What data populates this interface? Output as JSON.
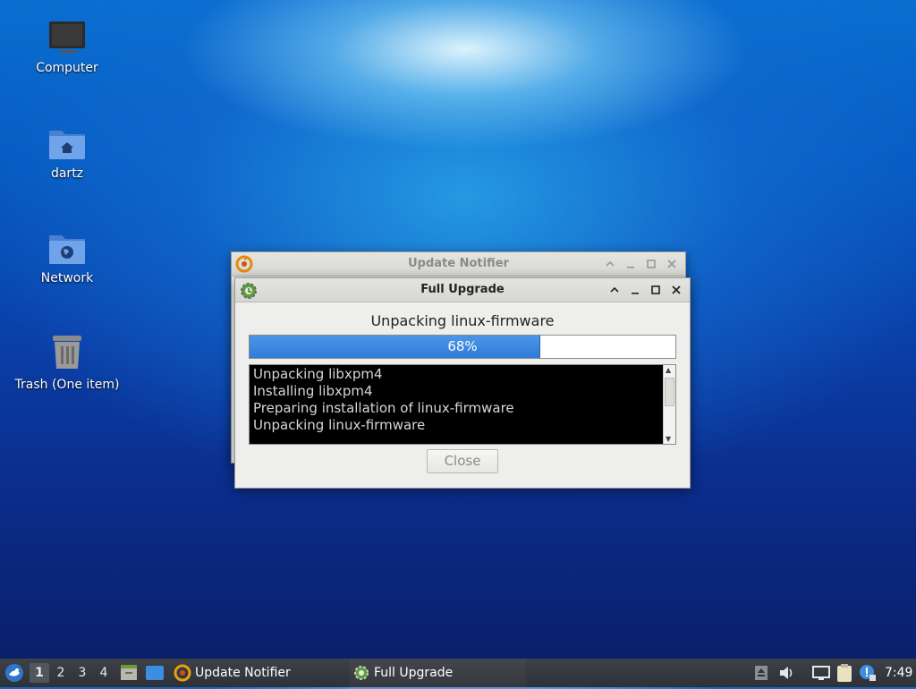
{
  "desktop": {
    "icons": [
      {
        "label": "Computer",
        "icon": "computer-icon"
      },
      {
        "label": "dartz",
        "icon": "home-folder-icon"
      },
      {
        "label": "Network",
        "icon": "network-folder-icon"
      },
      {
        "label": "Trash (One item)",
        "icon": "trash-icon"
      }
    ]
  },
  "update_notifier_window": {
    "title": "Update Notifier",
    "icon": "update-notifier-icon"
  },
  "full_upgrade_window": {
    "title": "Full Upgrade",
    "icon": "gear-upgrade-icon",
    "status": "Unpacking linux-firmware",
    "progress": {
      "value": 68,
      "label": "68%"
    },
    "log_lines": [
      "Unpacking libxpm4",
      "Installing libxpm4",
      "Preparing installation of linux-firmware",
      "Unpacking linux-firmware"
    ],
    "close_button": "Close"
  },
  "taskbar": {
    "workspaces": [
      "1",
      "2",
      "3",
      "4"
    ],
    "active_workspace": "1",
    "tasks": [
      {
        "label": "Update Notifier",
        "icon": "update-notifier-icon"
      },
      {
        "label": "Full Upgrade",
        "icon": "gear-upgrade-icon",
        "active": true
      }
    ],
    "clock": "7:49"
  },
  "colors": {
    "progress_fill": "#3a86df",
    "taskbar_bg": "#33363c",
    "log_bg": "#000000"
  }
}
